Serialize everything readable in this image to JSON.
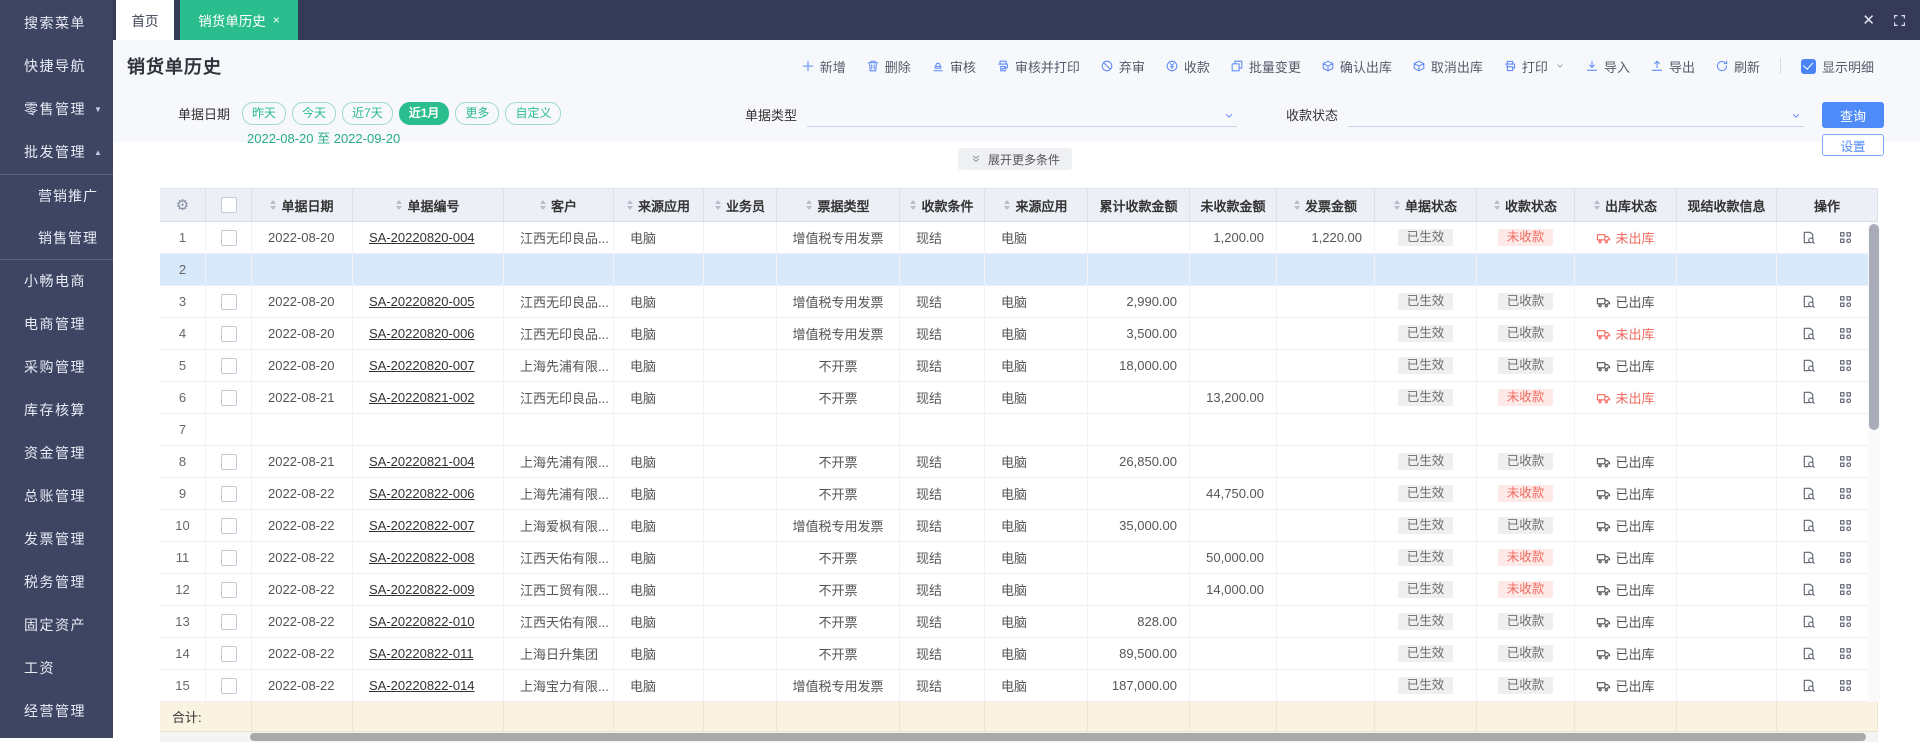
{
  "colors": {
    "accent_green": "#2abd8d",
    "accent_blue": "#4e8bf8",
    "alert_red": "#f2695c",
    "sidebar_bg": "#3e4563",
    "selected_row": "#d8e9fc",
    "total_row_bg": "#fbf3e2"
  },
  "sidebar": {
    "items": [
      {
        "label": "搜索菜单"
      },
      {
        "label": "快捷导航"
      },
      {
        "label": "零售管理",
        "caret": "down"
      },
      {
        "label": "批发管理",
        "caret": "up"
      },
      {
        "label": "营销推广",
        "sub": true,
        "group_start": true
      },
      {
        "label": "销售管理",
        "sub": true,
        "group_end": true
      },
      {
        "label": "小畅电商"
      },
      {
        "label": "电商管理"
      },
      {
        "label": "采购管理"
      },
      {
        "label": "库存核算"
      },
      {
        "label": "资金管理"
      },
      {
        "label": "总账管理"
      },
      {
        "label": "发票管理"
      },
      {
        "label": "税务管理"
      },
      {
        "label": "固定资产"
      },
      {
        "label": "工资"
      },
      {
        "label": "经营管理"
      }
    ]
  },
  "tabs": {
    "home": "首页",
    "active": "销货单历史",
    "close": "×"
  },
  "window": {
    "close": "✕"
  },
  "page": {
    "title": "销货单历史"
  },
  "toolbar": {
    "buttons": [
      {
        "icon": "plus",
        "label": "新增"
      },
      {
        "icon": "trash",
        "label": "删除"
      },
      {
        "icon": "audit",
        "label": "审核"
      },
      {
        "icon": "audit-print",
        "label": "审核并打印"
      },
      {
        "icon": "discard",
        "label": "弃审"
      },
      {
        "icon": "collect",
        "label": "收款"
      },
      {
        "icon": "batch",
        "label": "批量变更"
      },
      {
        "icon": "confirm-out",
        "label": "确认出库"
      },
      {
        "icon": "cancel-out",
        "label": "取消出库"
      },
      {
        "icon": "print",
        "label": "打印",
        "caret": true
      },
      {
        "icon": "import",
        "label": "导入"
      },
      {
        "icon": "export",
        "label": "导出"
      },
      {
        "icon": "refresh",
        "label": "刷新"
      }
    ],
    "show_detail": "显示明细"
  },
  "filters": {
    "date_label": "单据日期",
    "date_pills": [
      "昨天",
      "今天",
      "近7天",
      "近1月",
      "更多",
      "自定义"
    ],
    "active_pill": "近1月",
    "date_range": "2022-08-20 至 2022-09-20",
    "doc_type_label": "单据类型",
    "payment_status_label": "收款状态",
    "search_button": "查询",
    "settings_button": "设置",
    "expand_more": "展开更多条件"
  },
  "table": {
    "columns": [
      {
        "key": "num",
        "label": "",
        "sort": false
      },
      {
        "key": "check",
        "label": "",
        "sort": false
      },
      {
        "key": "date",
        "label": "单据日期",
        "sort": true
      },
      {
        "key": "code",
        "label": "单据编号",
        "sort": true
      },
      {
        "key": "customer",
        "label": "客户",
        "sort": true
      },
      {
        "key": "source",
        "label": "来源应用",
        "sort": true
      },
      {
        "key": "salesman",
        "label": "业务员",
        "sort": true
      },
      {
        "key": "bill_type",
        "label": "票据类型",
        "sort": true
      },
      {
        "key": "pay_cond",
        "label": "收款条件",
        "sort": true
      },
      {
        "key": "source2",
        "label": "来源应用",
        "sort": true
      },
      {
        "key": "received",
        "label": "累计收款金额",
        "sort": false
      },
      {
        "key": "unreceived",
        "label": "未收款金额",
        "sort": false
      },
      {
        "key": "invoice",
        "label": "发票金额",
        "sort": true
      },
      {
        "key": "doc_status",
        "label": "单据状态",
        "sort": true
      },
      {
        "key": "pay_status",
        "label": "收款状态",
        "sort": true
      },
      {
        "key": "out_status",
        "label": "出库状态",
        "sort": true
      },
      {
        "key": "cash_info",
        "label": "现结收款信息",
        "sort": false
      },
      {
        "key": "ops",
        "label": "操作",
        "sort": false
      }
    ],
    "rows": [
      {
        "num": "1",
        "date": "2022-08-20",
        "code": "SA-20220820-004",
        "customer": "江西无印良品...",
        "source": "电脑",
        "salesman": "",
        "bill_type": "增值税专用发票",
        "pay_cond": "现结",
        "source2": "电脑",
        "received": "",
        "unreceived": "1,200.00",
        "invoice": "1,220.00",
        "doc_status": "已生效",
        "pay_status": "未收款",
        "out_status": "未出库",
        "cash_info": ""
      },
      {
        "num": "2",
        "empty": true,
        "selected": true
      },
      {
        "num": "3",
        "date": "2022-08-20",
        "code": "SA-20220820-005",
        "customer": "江西无印良品...",
        "source": "电脑",
        "salesman": "",
        "bill_type": "增值税专用发票",
        "pay_cond": "现结",
        "source2": "电脑",
        "received": "2,990.00",
        "unreceived": "",
        "invoice": "",
        "doc_status": "已生效",
        "pay_status": "已收款",
        "out_status": "已出库",
        "cash_info": ""
      },
      {
        "num": "4",
        "date": "2022-08-20",
        "code": "SA-20220820-006",
        "customer": "江西无印良品...",
        "source": "电脑",
        "salesman": "",
        "bill_type": "增值税专用发票",
        "pay_cond": "现结",
        "source2": "电脑",
        "received": "3,500.00",
        "unreceived": "",
        "invoice": "",
        "doc_status": "已生效",
        "pay_status": "已收款",
        "out_status": "未出库",
        "cash_info": ""
      },
      {
        "num": "5",
        "date": "2022-08-20",
        "code": "SA-20220820-007",
        "customer": "上海先浦有限...",
        "source": "电脑",
        "salesman": "",
        "bill_type": "不开票",
        "pay_cond": "现结",
        "source2": "电脑",
        "received": "18,000.00",
        "unreceived": "",
        "invoice": "",
        "doc_status": "已生效",
        "pay_status": "已收款",
        "out_status": "已出库",
        "cash_info": ""
      },
      {
        "num": "6",
        "date": "2022-08-21",
        "code": "SA-20220821-002",
        "customer": "江西无印良品...",
        "source": "电脑",
        "salesman": "",
        "bill_type": "不开票",
        "pay_cond": "现结",
        "source2": "电脑",
        "received": "",
        "unreceived": "13,200.00",
        "invoice": "",
        "doc_status": "已生效",
        "pay_status": "未收款",
        "out_status": "未出库",
        "cash_info": ""
      },
      {
        "num": "7",
        "empty": true
      },
      {
        "num": "8",
        "date": "2022-08-21",
        "code": "SA-20220821-004",
        "customer": "上海先浦有限...",
        "source": "电脑",
        "salesman": "",
        "bill_type": "不开票",
        "pay_cond": "现结",
        "source2": "电脑",
        "received": "26,850.00",
        "unreceived": "",
        "invoice": "",
        "doc_status": "已生效",
        "pay_status": "已收款",
        "out_status": "已出库",
        "cash_info": ""
      },
      {
        "num": "9",
        "date": "2022-08-22",
        "code": "SA-20220822-006",
        "customer": "上海先浦有限...",
        "source": "电脑",
        "salesman": "",
        "bill_type": "不开票",
        "pay_cond": "现结",
        "source2": "电脑",
        "received": "",
        "unreceived": "44,750.00",
        "invoice": "",
        "doc_status": "已生效",
        "pay_status": "未收款",
        "out_status": "已出库",
        "cash_info": ""
      },
      {
        "num": "10",
        "date": "2022-08-22",
        "code": "SA-20220822-007",
        "customer": "上海爱枫有限...",
        "source": "电脑",
        "salesman": "",
        "bill_type": "增值税专用发票",
        "pay_cond": "现结",
        "source2": "电脑",
        "received": "35,000.00",
        "unreceived": "",
        "invoice": "",
        "doc_status": "已生效",
        "pay_status": "已收款",
        "out_status": "已出库",
        "cash_info": ""
      },
      {
        "num": "11",
        "date": "2022-08-22",
        "code": "SA-20220822-008",
        "customer": "江西天佑有限...",
        "source": "电脑",
        "salesman": "",
        "bill_type": "不开票",
        "pay_cond": "现结",
        "source2": "电脑",
        "received": "",
        "unreceived": "50,000.00",
        "invoice": "",
        "doc_status": "已生效",
        "pay_status": "未收款",
        "out_status": "已出库",
        "cash_info": ""
      },
      {
        "num": "12",
        "date": "2022-08-22",
        "code": "SA-20220822-009",
        "customer": "江西工贸有限...",
        "source": "电脑",
        "salesman": "",
        "bill_type": "不开票",
        "pay_cond": "现结",
        "source2": "电脑",
        "received": "",
        "unreceived": "14,000.00",
        "invoice": "",
        "doc_status": "已生效",
        "pay_status": "未收款",
        "out_status": "已出库",
        "cash_info": ""
      },
      {
        "num": "13",
        "date": "2022-08-22",
        "code": "SA-20220822-010",
        "customer": "江西天佑有限...",
        "source": "电脑",
        "salesman": "",
        "bill_type": "不开票",
        "pay_cond": "现结",
        "source2": "电脑",
        "received": "828.00",
        "unreceived": "",
        "invoice": "",
        "doc_status": "已生效",
        "pay_status": "已收款",
        "out_status": "已出库",
        "cash_info": ""
      },
      {
        "num": "14",
        "date": "2022-08-22",
        "code": "SA-20220822-011",
        "customer": "上海日升集团",
        "source": "电脑",
        "salesman": "",
        "bill_type": "不开票",
        "pay_cond": "现结",
        "source2": "电脑",
        "received": "89,500.00",
        "unreceived": "",
        "invoice": "",
        "doc_status": "已生效",
        "pay_status": "已收款",
        "out_status": "已出库",
        "cash_info": ""
      },
      {
        "num": "15",
        "date": "2022-08-22",
        "code": "SA-20220822-014",
        "customer": "上海宝力有限...",
        "source": "电脑",
        "salesman": "",
        "bill_type": "增值税专用发票",
        "pay_cond": "现结",
        "source2": "电脑",
        "received": "187,000.00",
        "unreceived": "",
        "invoice": "",
        "doc_status": "已生效",
        "pay_status": "已收款",
        "out_status": "已出库",
        "cash_info": ""
      }
    ],
    "total_label": "合计:"
  }
}
